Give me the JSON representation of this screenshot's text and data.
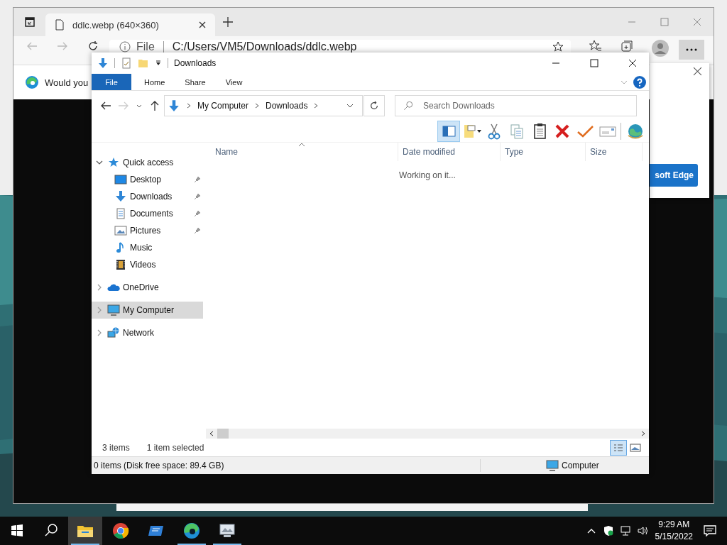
{
  "browser": {
    "tab": {
      "title": "ddlc.webp (640×360)"
    },
    "address": {
      "scheme": "File",
      "url": "C:/Users/VM5/Downloads/ddlc.webp"
    },
    "infobar": {
      "message": "Would you",
      "button": "soft Edge"
    }
  },
  "explorer": {
    "title": "Downloads",
    "ribbon_tabs": [
      {
        "label": "File",
        "kind": "file"
      },
      {
        "label": "Home",
        "kind": "tab"
      },
      {
        "label": "Share",
        "kind": "tab"
      },
      {
        "label": "View",
        "kind": "tab"
      }
    ],
    "breadcrumb": [
      "My Computer",
      "Downloads"
    ],
    "search": {
      "placeholder": "Search Downloads"
    },
    "toolbar": [
      {
        "kind": "pane",
        "pressed": true
      },
      {
        "kind": "folder",
        "pressed": false
      },
      {
        "kind": "cut",
        "pressed": false
      },
      {
        "kind": "copy",
        "pressed": false
      },
      {
        "kind": "paste",
        "pressed": false
      },
      {
        "kind": "delete",
        "pressed": false
      },
      {
        "kind": "check",
        "pressed": false
      },
      {
        "kind": "mail",
        "pressed": false
      },
      {
        "kind": "globe",
        "pressed": false
      }
    ],
    "nav": [
      {
        "label": "Quick access",
        "kind": "star",
        "expanded": true,
        "selected": false,
        "children": [
          {
            "label": "Desktop",
            "kind": "desktop",
            "pinned": true,
            "selected": false
          },
          {
            "label": "Downloads",
            "kind": "download",
            "pinned": true,
            "selected": false
          },
          {
            "label": "Documents",
            "kind": "document",
            "pinned": true,
            "selected": false
          },
          {
            "label": "Pictures",
            "kind": "pictures",
            "pinned": true,
            "selected": false
          },
          {
            "label": "Music",
            "kind": "music",
            "pinned": false,
            "selected": false
          },
          {
            "label": "Videos",
            "kind": "videos",
            "pinned": false,
            "selected": false
          }
        ]
      },
      {
        "label": "OneDrive",
        "kind": "cloud",
        "expanded": false,
        "selected": false
      },
      {
        "label": "My Computer",
        "kind": "computer",
        "expanded": false,
        "selected": true
      },
      {
        "label": "Network",
        "kind": "network",
        "expanded": false,
        "selected": false
      }
    ],
    "columns": [
      {
        "label": "Name",
        "sorted": true
      },
      {
        "label": "Date modified",
        "sorted": false
      },
      {
        "label": "Type",
        "sorted": false
      },
      {
        "label": "Size",
        "sorted": false
      }
    ],
    "message": "Working on it...",
    "status": {
      "items": "3 items",
      "selected": "1 item selected"
    },
    "views": [
      {
        "kind": "details",
        "selected": true
      },
      {
        "kind": "tiles",
        "selected": false
      }
    ],
    "bottom_bar": {
      "info": "0 items (Disk free space: 89.4 GB)",
      "location": "Computer"
    }
  },
  "taskbar": {
    "apps": [
      {
        "kind": "explorer",
        "running": true,
        "active": true
      },
      {
        "kind": "chrome",
        "running": false,
        "active": false
      },
      {
        "kind": "app",
        "running": false,
        "active": false
      },
      {
        "kind": "edge",
        "running": true,
        "active": false
      },
      {
        "kind": "monitor",
        "running": true,
        "active": false
      }
    ],
    "clock": {
      "time": "9:29 AM",
      "date": "5/15/2022"
    }
  }
}
